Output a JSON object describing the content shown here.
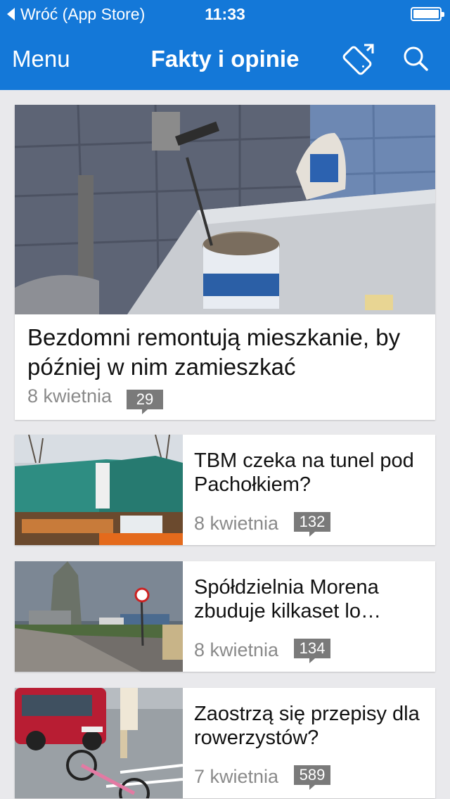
{
  "status_bar": {
    "back_label": "Wróć (App Store)",
    "time": "11:33"
  },
  "nav": {
    "menu_label": "Menu",
    "title": "Fakty i opinie",
    "icons": [
      "rotate-device-icon",
      "search-icon"
    ]
  },
  "colors": {
    "brand_blue": "#1478d8",
    "badge_gray": "#7a7a7a",
    "background": "#e9e9ec"
  },
  "articles": [
    {
      "title": "Bezdomni remontują mieszkanie, by później w nim zamieszkać",
      "date": "8 kwietnia",
      "comments": "29"
    },
    {
      "title": "TBM czeka na tunel pod Pachołkiem?",
      "date": "8 kwietnia",
      "comments": "132"
    },
    {
      "title": "Spółdzielnia Morena zbuduje kilkaset lo…",
      "date": "8 kwietnia",
      "comments": "134"
    },
    {
      "title": "Zaostrzą się przepisy dla rowerzystów?",
      "date": "7 kwietnia",
      "comments": "589"
    }
  ]
}
